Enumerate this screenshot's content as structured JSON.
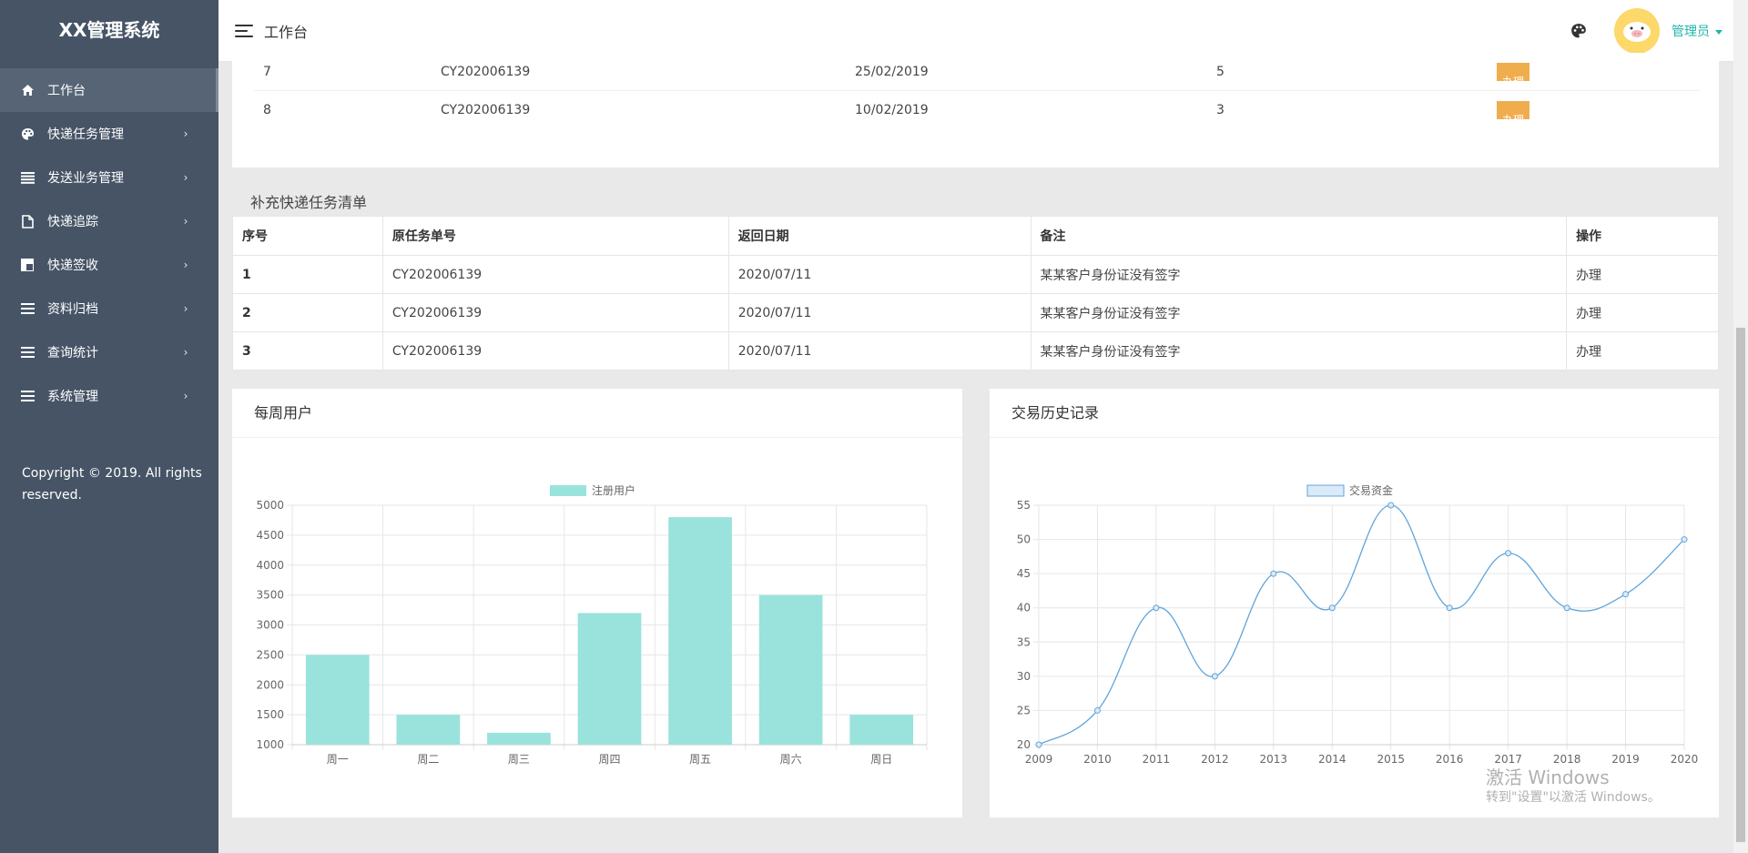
{
  "app": {
    "title": "XX管理系统"
  },
  "sidebar": {
    "items": [
      {
        "label": "工作台",
        "icon": "home-icon"
      },
      {
        "label": "快递任务管理",
        "icon": "palette-icon"
      },
      {
        "label": "发送业务管理",
        "icon": "list-icon"
      },
      {
        "label": "快递追踪",
        "icon": "file-icon"
      },
      {
        "label": "快递签收",
        "icon": "js-icon"
      },
      {
        "label": "资料归档",
        "icon": "bars-icon"
      },
      {
        "label": "查询统计",
        "icon": "bars-icon"
      },
      {
        "label": "系统管理",
        "icon": "bars-icon"
      }
    ],
    "copyright": "Copyright © 2019. All rights reserved."
  },
  "header": {
    "title": "工作台",
    "user": "管理员"
  },
  "task_rows": [
    {
      "index": "7",
      "order": "CY202006139",
      "date": "25/02/2019",
      "count": "5",
      "action": "办理"
    },
    {
      "index": "8",
      "order": "CY202006139",
      "date": "10/02/2019",
      "count": "3",
      "action": "办理"
    }
  ],
  "supplement": {
    "title": "补充快递任务清单",
    "columns": [
      "序号",
      "原任务单号",
      "返回日期",
      "备注",
      "操作"
    ],
    "rows": [
      {
        "index": "1",
        "order": "CY202006139",
        "date": "2020/07/11",
        "note": "某某客户身份证没有签字",
        "action": "办理"
      },
      {
        "index": "2",
        "order": "CY202006139",
        "date": "2020/07/11",
        "note": "某某客户身份证没有签字",
        "action": "办理"
      },
      {
        "index": "3",
        "order": "CY202006139",
        "date": "2020/07/11",
        "note": "某某客户身份证没有签字",
        "action": "办理"
      }
    ]
  },
  "charts": {
    "weekly_title": "每周用户",
    "history_title": "交易历史记录"
  },
  "chart_data": [
    {
      "type": "bar",
      "title": "每周用户",
      "categories": [
        "周一",
        "周二",
        "周三",
        "周四",
        "周五",
        "周六",
        "周日"
      ],
      "series": [
        {
          "name": "注册用户",
          "values": [
            2500,
            1500,
            1200,
            3200,
            4800,
            3500,
            1500
          ]
        }
      ],
      "ylim": [
        1000,
        5000
      ],
      "yticks": [
        1000,
        1500,
        2000,
        2500,
        3000,
        3500,
        4000,
        4500,
        5000
      ],
      "color": "#99e3dc",
      "grid": true,
      "legend": "top-center"
    },
    {
      "type": "line",
      "title": "交易历史记录",
      "x": [
        "2009",
        "2010",
        "2011",
        "2012",
        "2013",
        "2014",
        "2015",
        "2016",
        "2017",
        "2018",
        "2019",
        "2020"
      ],
      "series": [
        {
          "name": "交易资金",
          "values": [
            20,
            25,
            40,
            30,
            45,
            40,
            55,
            40,
            48,
            40,
            42,
            50
          ]
        }
      ],
      "ylim": [
        20,
        55
      ],
      "yticks": [
        20,
        25,
        30,
        35,
        40,
        45,
        50,
        55
      ],
      "color": "#5fa5dc",
      "grid": true,
      "legend": "top-center"
    }
  ],
  "watermark": {
    "line1": "激活 Windows",
    "line2": "转到\"设置\"以激活 Windows。"
  }
}
